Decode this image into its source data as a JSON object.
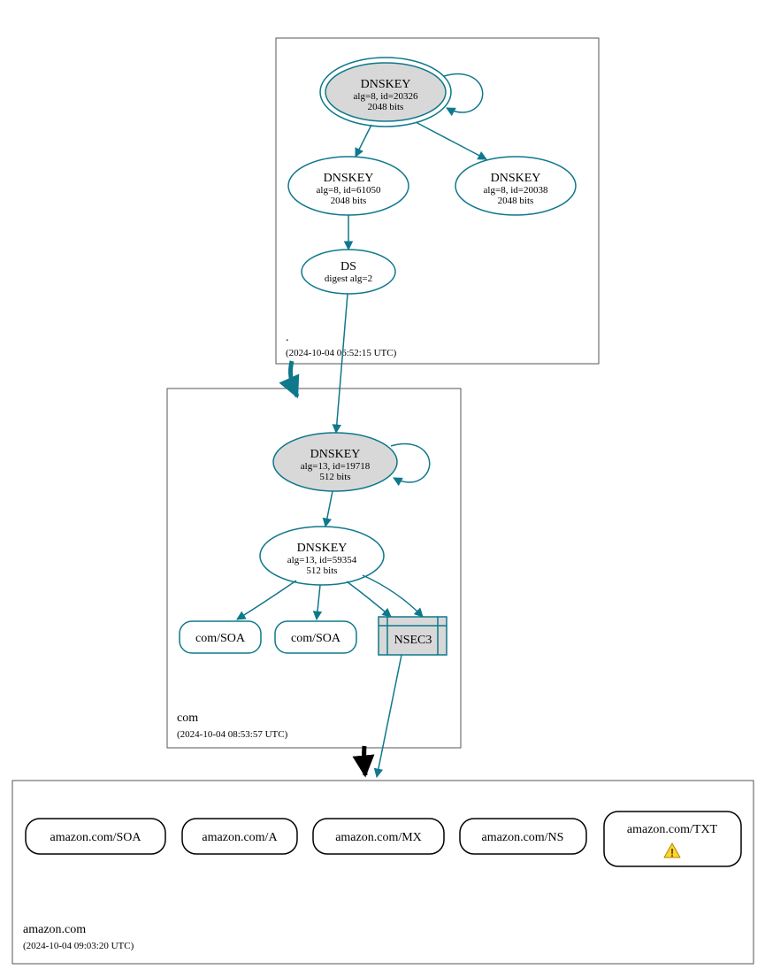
{
  "zones": {
    "root": {
      "name": ".",
      "timestamp": "(2024-10-04 06:52:15 UTC)"
    },
    "com": {
      "name": "com",
      "timestamp": "(2024-10-04 08:53:57 UTC)"
    },
    "amazon": {
      "name": "amazon.com",
      "timestamp": "(2024-10-04 09:03:20 UTC)"
    }
  },
  "nodes": {
    "root_ksk": {
      "title": "DNSKEY",
      "line2": "alg=8, id=20326",
      "line3": "2048 bits"
    },
    "root_zsk1": {
      "title": "DNSKEY",
      "line2": "alg=8, id=61050",
      "line3": "2048 bits"
    },
    "root_zsk2": {
      "title": "DNSKEY",
      "line2": "alg=8, id=20038",
      "line3": "2048 bits"
    },
    "root_ds": {
      "title": "DS",
      "line2": "digest alg=2"
    },
    "com_ksk": {
      "title": "DNSKEY",
      "line2": "alg=13, id=19718",
      "line3": "512 bits"
    },
    "com_zsk": {
      "title": "DNSKEY",
      "line2": "alg=13, id=59354",
      "line3": "512 bits"
    },
    "com_soa1": "com/SOA",
    "com_soa2": "com/SOA",
    "nsec3": "NSEC3",
    "az_soa": "amazon.com/SOA",
    "az_a": "amazon.com/A",
    "az_mx": "amazon.com/MX",
    "az_ns": "amazon.com/NS",
    "az_txt": "amazon.com/TXT"
  }
}
